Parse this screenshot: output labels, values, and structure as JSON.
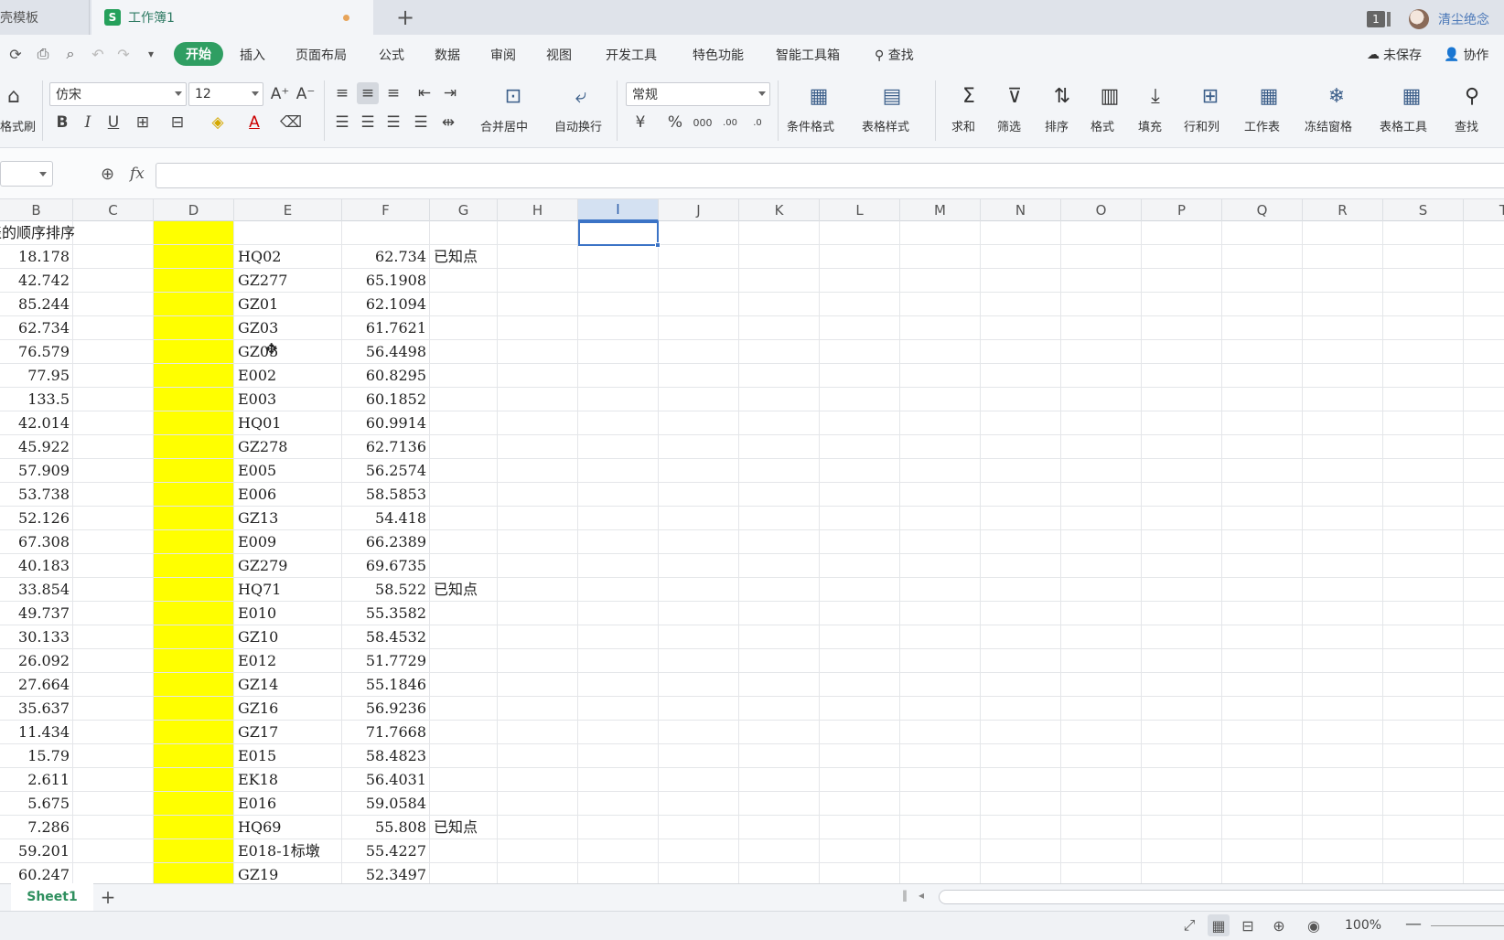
{
  "tabs": {
    "template_label": "稻壳模板",
    "workbook_icon": "S",
    "workbook_label": "工作簿1",
    "badge": "1",
    "username": "清尘绝念"
  },
  "menu": {
    "start": "开始",
    "items": [
      "插入",
      "页面布局",
      "公式",
      "数据",
      "审阅",
      "视图",
      "开发工具",
      "特色功能",
      "智能工具箱",
      "查找"
    ],
    "unsaved": "未保存",
    "collab": "协作"
  },
  "ribbon": {
    "format_painter": "格式刷",
    "font_name": "仿宋",
    "font_size": "12",
    "number_format": "常规",
    "merge_center": "合并居中",
    "wrap_text": "自动换行",
    "conditional_format": "条件格式",
    "table_style": "表格样式",
    "sum": "求和",
    "filter": "筛选",
    "sort": "排序",
    "format": "格式",
    "fill": "填充",
    "rows_cols": "行和列",
    "worksheet": "工作表",
    "freeze": "冻结窗格",
    "table_tools": "表格工具",
    "find": "查找"
  },
  "columns": [
    "B",
    "C",
    "D",
    "E",
    "F",
    "G",
    "H",
    "I",
    "J",
    "K",
    "L",
    "M",
    "N",
    "O",
    "P",
    "Q",
    "R",
    "S",
    "T"
  ],
  "header_text": "表的顺序排序",
  "rows": [
    {
      "b": "18.178",
      "e": "HQ02",
      "f": "62.734",
      "g": "已知点"
    },
    {
      "b": "42.742",
      "e": "GZ277",
      "f": "65.1908",
      "g": ""
    },
    {
      "b": "85.244",
      "e": "GZ01",
      "f": "62.1094",
      "g": ""
    },
    {
      "b": "62.734",
      "e": "GZ03",
      "f": "61.7621",
      "g": ""
    },
    {
      "b": "76.579",
      "e": "GZ05",
      "f": "56.4498",
      "g": ""
    },
    {
      "b": "77.95",
      "e": "E002",
      "f": "60.8295",
      "g": ""
    },
    {
      "b": "133.5",
      "e": "E003",
      "f": "60.1852",
      "g": ""
    },
    {
      "b": "42.014",
      "e": "HQ01",
      "f": "60.9914",
      "g": ""
    },
    {
      "b": "45.922",
      "e": "GZ278",
      "f": "62.7136",
      "g": ""
    },
    {
      "b": "57.909",
      "e": "E005",
      "f": "56.2574",
      "g": ""
    },
    {
      "b": "53.738",
      "e": "E006",
      "f": "58.5853",
      "g": ""
    },
    {
      "b": "52.126",
      "e": "GZ13",
      "f": "54.418",
      "g": ""
    },
    {
      "b": "67.308",
      "e": "E009",
      "f": "66.2389",
      "g": ""
    },
    {
      "b": "40.183",
      "e": "GZ279",
      "f": "69.6735",
      "g": ""
    },
    {
      "b": "33.854",
      "e": "HQ71",
      "f": "58.522",
      "g": "已知点"
    },
    {
      "b": "49.737",
      "e": "E010",
      "f": "55.3582",
      "g": ""
    },
    {
      "b": "30.133",
      "e": "GZ10",
      "f": "58.4532",
      "g": ""
    },
    {
      "b": "26.092",
      "e": "E012",
      "f": "51.7729",
      "g": ""
    },
    {
      "b": "27.664",
      "e": "GZ14",
      "f": "55.1846",
      "g": ""
    },
    {
      "b": "35.637",
      "e": "GZ16",
      "f": "56.9236",
      "g": ""
    },
    {
      "b": "11.434",
      "e": "GZ17",
      "f": "71.7668",
      "g": ""
    },
    {
      "b": "15.79",
      "e": "E015",
      "f": "58.4823",
      "g": ""
    },
    {
      "b": "2.611",
      "e": "EK18",
      "f": "56.4031",
      "g": ""
    },
    {
      "b": "5.675",
      "e": "E016",
      "f": "59.0584",
      "g": ""
    },
    {
      "b": "7.286",
      "e": "HQ69",
      "f": "55.808",
      "g": "已知点"
    },
    {
      "b": "59.201",
      "e": "E018-1标墩",
      "f": "55.4227",
      "g": ""
    },
    {
      "b": "60.247",
      "e": "GZ19",
      "f": "52.3497",
      "g": ""
    }
  ],
  "sheet": {
    "name": "Sheet1"
  },
  "status": {
    "zoom": "100%"
  },
  "colors": {
    "accent_green": "#2f9e62",
    "highlight_yellow": "#ffff00",
    "selection_blue": "#3b73c6"
  }
}
